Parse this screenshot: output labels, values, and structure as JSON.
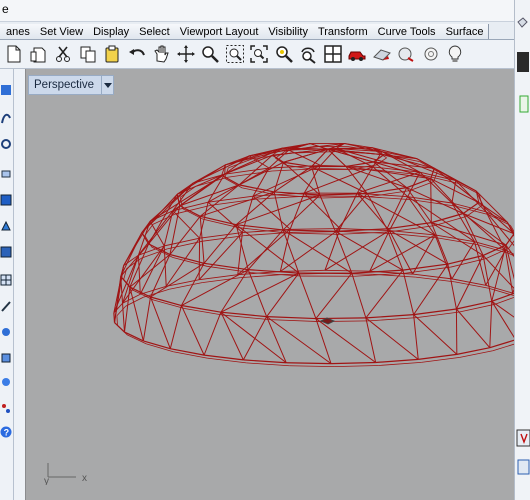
{
  "title_fragment": "e",
  "tabs": [
    "anes",
    "Set View",
    "Display",
    "Select",
    "Viewport Layout",
    "Visibility",
    "Transform",
    "Curve Tools",
    "Surface"
  ],
  "viewport": {
    "label": "Perspective",
    "axis_labels": {
      "y": "y",
      "x": "x"
    },
    "background": "#a8a9aa",
    "wire_color": "#a01414"
  },
  "toolbar_icons": [
    "new-file-icon",
    "open-file-icon",
    "cut-icon",
    "copy-icon",
    "paste-icon",
    "undo-icon",
    "pan-icon",
    "rotate-view-icon",
    "zoom-icon",
    "zoom-window-icon",
    "zoom-extents-icon",
    "zoom-selected-icon",
    "rotate-camera-icon",
    "four-viewports-icon",
    "car-render-icon",
    "shaded-icon",
    "material-icon",
    "ghosted-icon",
    "light-bulb-icon"
  ],
  "left_toolbar_icons": [
    "point-icon",
    "curve-icon",
    "circle-icon",
    "arc-icon",
    "rectangle-icon",
    "surface-icon",
    "solid-icon",
    "mesh-icon",
    "dimension-icon",
    "transform-icon",
    "array-icon",
    "group-icon",
    "analyze-icon",
    "help-icon"
  ]
}
